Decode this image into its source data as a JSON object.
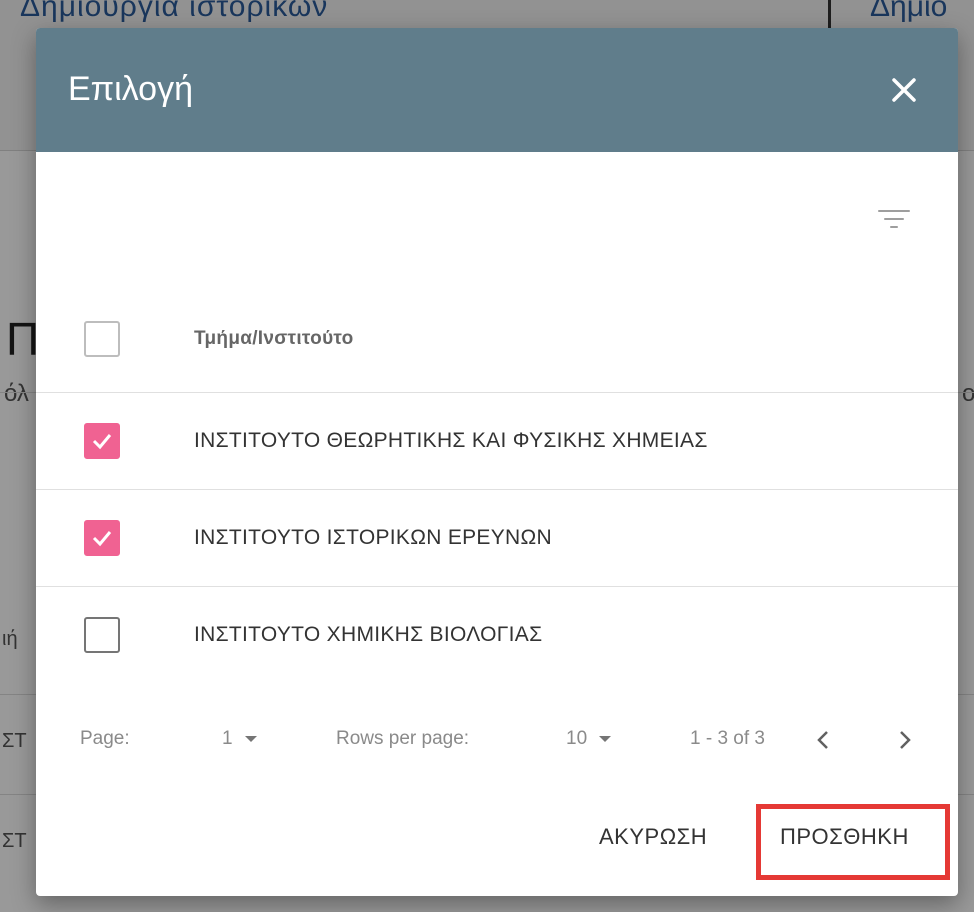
{
  "background": {
    "top_left_text": "Δημιουργία ιστορικών",
    "top_right_text": "Δημιο",
    "heading_fragment": "Πλ",
    "subtext_left": "όλ",
    "subtext_right": "ο",
    "row_fragments": [
      "ιή",
      "ΣΤ",
      "ΣΤ"
    ]
  },
  "dialog": {
    "title": "Επιλογή",
    "close_icon": "close-icon",
    "filter_icon": "filter-icon",
    "column_header": "Τμήμα/Ινστιτούτο",
    "rows": [
      {
        "label": "ΙΝΣΤΙΤΟΥΤΟ ΘΕΩΡΗΤΙΚΗΣ ΚΑΙ ΦΥΣΙΚΗΣ ΧΗΜΕΙΑΣ",
        "checked": true
      },
      {
        "label": "ΙΝΣΤΙΤΟΥΤΟ ΙΣΤΟΡΙΚΩΝ ΕΡΕΥΝΩΝ",
        "checked": true
      },
      {
        "label": "ΙΝΣΤΙΤΟΥΤΟ ΧΗΜΙΚΗΣ ΒΙΟΛΟΓΙΑΣ",
        "checked": false
      }
    ],
    "pagination": {
      "page_label": "Page:",
      "page_value": "1",
      "rows_per_page_label": "Rows per page:",
      "rows_per_page_value": "10",
      "range_text": "1 - 3 of 3"
    },
    "actions": {
      "cancel_label": "ΑΚΥΡΩΣΗ",
      "add_label": "ΠΡΟΣΘΗΚΗ"
    },
    "colors": {
      "header_bg": "#607d8b",
      "checkbox_checked": "#f06292",
      "highlight": "#e53935"
    }
  }
}
